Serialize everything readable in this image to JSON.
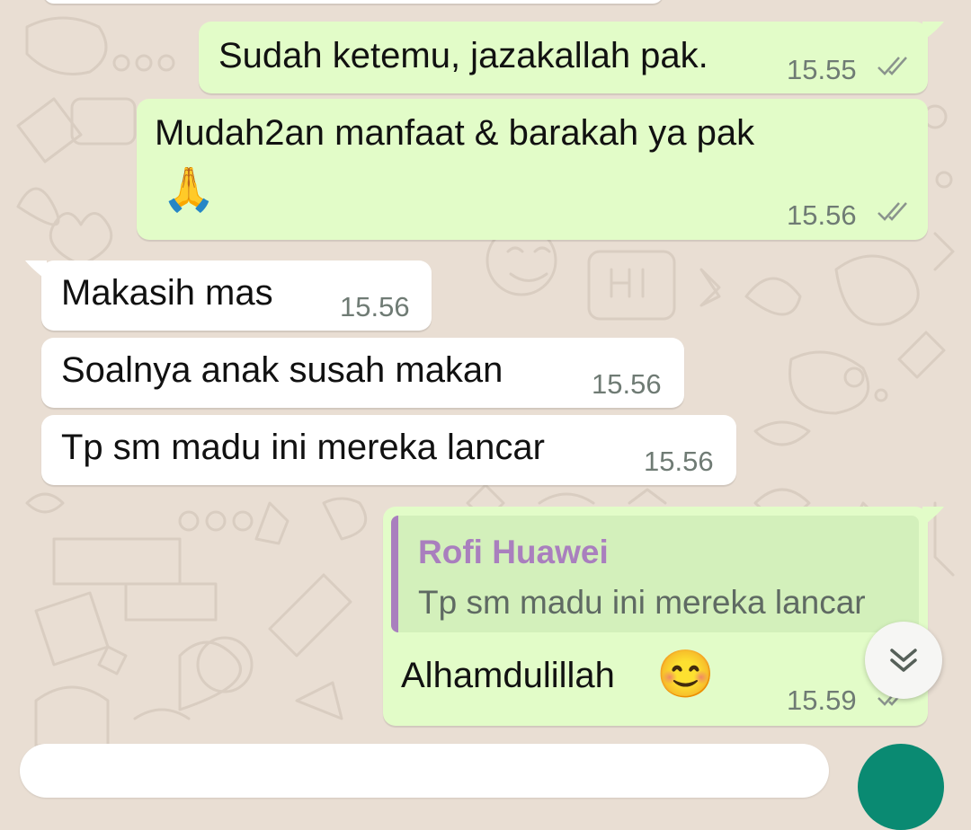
{
  "messages": [
    {
      "text": "Sudah ketemu, jazakallah pak.",
      "time": "15.55"
    },
    {
      "text": "Mudah2an manfaat &  barakah ya pak",
      "emoji": "🙏",
      "time": "15.56"
    },
    {
      "text": "Makasih mas",
      "time": "15.56"
    },
    {
      "text": "Soalnya anak susah makan",
      "time": "15.56"
    },
    {
      "text": "Tp sm madu ini mereka lancar",
      "time": "15.56"
    },
    {
      "quote_author": "Rofi Huawei",
      "quote_text": "Tp sm madu ini mereka lancar",
      "text": "Alhamdulillah",
      "emoji": "😊",
      "time": "15.59"
    }
  ],
  "icons": {
    "read_receipt": "double-check-icon",
    "scroll_down": "chevron-double-down-icon"
  },
  "colors": {
    "outgoing_bubble": "#e2fcc8",
    "incoming_bubble": "#ffffff",
    "chat_background": "#e9ded3",
    "quote_accent": "#a97fbe",
    "send_button": "#0a8a72"
  }
}
